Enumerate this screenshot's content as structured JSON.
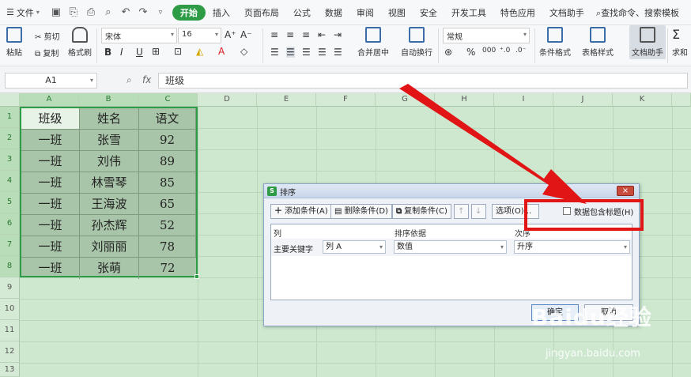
{
  "menubar": {
    "file_label": "文件",
    "tabs": [
      "开始",
      "插入",
      "页面布局",
      "公式",
      "数据",
      "审阅",
      "视图",
      "安全",
      "开发工具",
      "特色应用",
      "文档助手"
    ],
    "search_label": "查找命令、搜索模板"
  },
  "ribbon": {
    "paste": "粘贴",
    "cut": "剪切",
    "copy": "复制",
    "format_painter": "格式刷",
    "font_name": "宋体",
    "font_size": "16",
    "merge_center": "合并居中",
    "wrap_text": "自动换行",
    "number_format": "常规",
    "percent": "%",
    "conditional_format": "条件格式",
    "table_style": "表格样式",
    "doc_assistant": "文档助手",
    "sum": "求和"
  },
  "formula_bar": {
    "cell_ref": "A1",
    "fx": "fx",
    "value": "班级"
  },
  "grid": {
    "columns": [
      "A",
      "B",
      "C",
      "D",
      "E",
      "F",
      "G",
      "H",
      "I",
      "J",
      "K"
    ],
    "rows": [
      "1",
      "2",
      "3",
      "4",
      "5",
      "6",
      "7",
      "8",
      "9",
      "10",
      "11",
      "12",
      "13"
    ],
    "table": [
      [
        "班级",
        "姓名",
        "语文"
      ],
      [
        "一班",
        "张雪",
        "92"
      ],
      [
        "一班",
        "刘伟",
        "89"
      ],
      [
        "一班",
        "林雪琴",
        "85"
      ],
      [
        "一班",
        "王海波",
        "65"
      ],
      [
        "一班",
        "孙杰辉",
        "52"
      ],
      [
        "一班",
        "刘丽丽",
        "78"
      ],
      [
        "一班",
        "张萌",
        "72"
      ]
    ]
  },
  "dialog": {
    "title": "排序",
    "close": "×",
    "add_condition": "添加条件(A)",
    "delete_condition": "删除条件(D)",
    "copy_condition": "复制条件(C)",
    "move_up": "↑",
    "move_down": "↓",
    "options": "选项(O)...",
    "has_header_label": "数据包含标题(H)",
    "has_header_checked": false,
    "col_header": "列",
    "sort_on_header": "排序依据",
    "order_header": "次序",
    "primary_key_label": "主要关键字",
    "primary_key_value": "列 A",
    "sort_on_value": "数值",
    "order_value": "升序",
    "ok": "确定",
    "cancel": "取消"
  },
  "watermark": {
    "brand": "Baidu经验",
    "url": "jingyan.baidu.com"
  },
  "colors": {
    "accent": "#2e9b46",
    "grid_bg": "#cde8cf",
    "highlight_red": "#e11515"
  }
}
